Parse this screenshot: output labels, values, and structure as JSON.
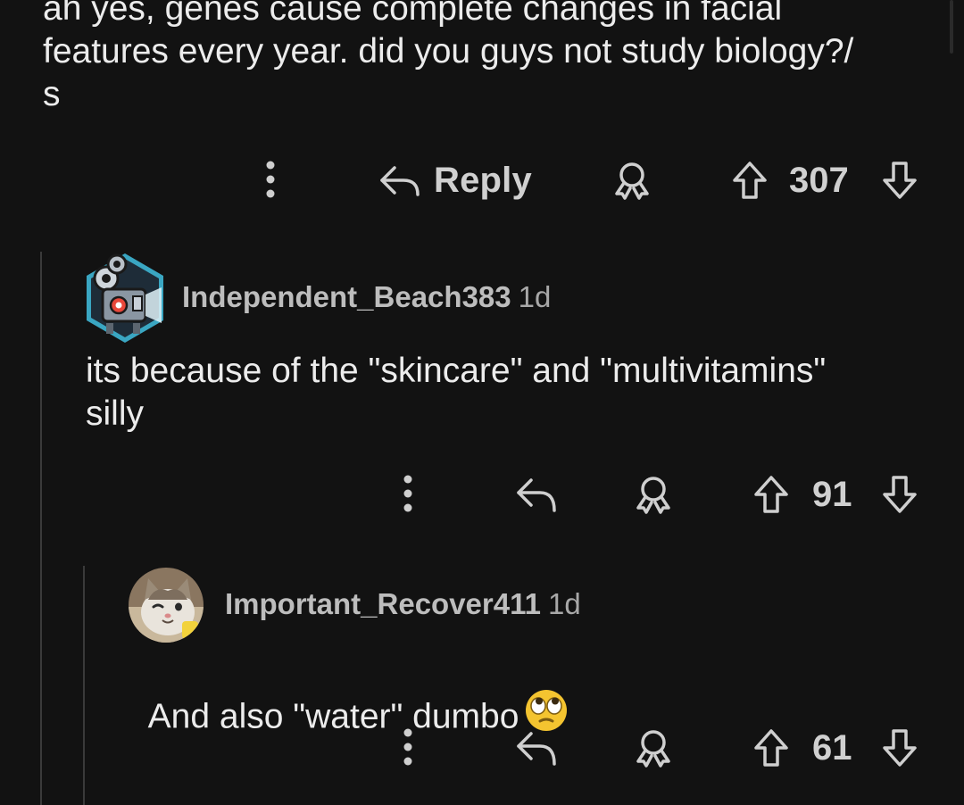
{
  "top_comment": {
    "body": "ah yes, genes cause complete changes in facial\nfeatures every year. did you guys not study biology?/\ns",
    "actions": {
      "reply_label": "Reply",
      "score": "307"
    }
  },
  "replies": [
    {
      "username": "Independent_Beach383",
      "time": "1d",
      "avatar_icon": "film-projector-robot-avatar",
      "body": "its because of the \"skincare\" and \"multivitamins\"\nsilly",
      "score": "91"
    },
    {
      "username": "Important_Recover411",
      "time": "1d",
      "avatar_icon": "cat-avatar",
      "body": "And also \"water\" dumbo",
      "emoji": "face-with-rolling-eyes",
      "score": "61"
    }
  ],
  "colors": {
    "background": "#121212",
    "text": "#ececec",
    "muted": "#bdbdbd",
    "thread_line": "#3a3a3a"
  }
}
